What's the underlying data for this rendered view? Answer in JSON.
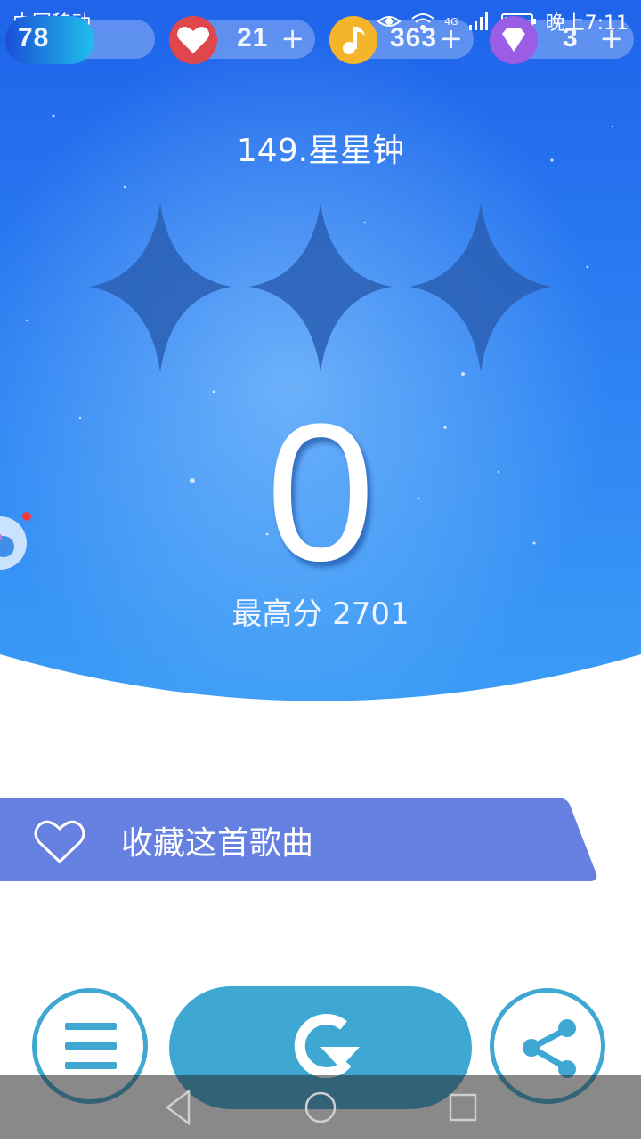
{
  "status_bar": {
    "carrier": "中国移动",
    "network": "4G",
    "time": "晚上7:11"
  },
  "resources": {
    "level": {
      "value": "78",
      "icon": "level-badge-icon"
    },
    "hearts": {
      "value": "21",
      "icon": "heart-icon",
      "plus": "+"
    },
    "notes": {
      "value": "363",
      "icon": "music-note-icon",
      "plus": "+"
    },
    "diamonds": {
      "value": "3",
      "icon": "diamond-icon",
      "plus": "+"
    }
  },
  "song": {
    "title": "149.星星钟"
  },
  "result": {
    "stars_earned": 0,
    "stars_total": 3,
    "score": "0",
    "best_label": "最高分 2701"
  },
  "favorite": {
    "label": "收藏这首歌曲",
    "icon": "heart-outline-icon"
  },
  "actions": {
    "menu_icon": "menu-icon",
    "retry_icon": "retry-icon",
    "share_icon": "share-icon"
  },
  "colors": {
    "sky_top": "#2a6ff0",
    "sky_bottom": "#2f8ff5",
    "banner": "#6580e0",
    "button": "#3ea8d2",
    "star_empty": "#2a5fb4"
  }
}
